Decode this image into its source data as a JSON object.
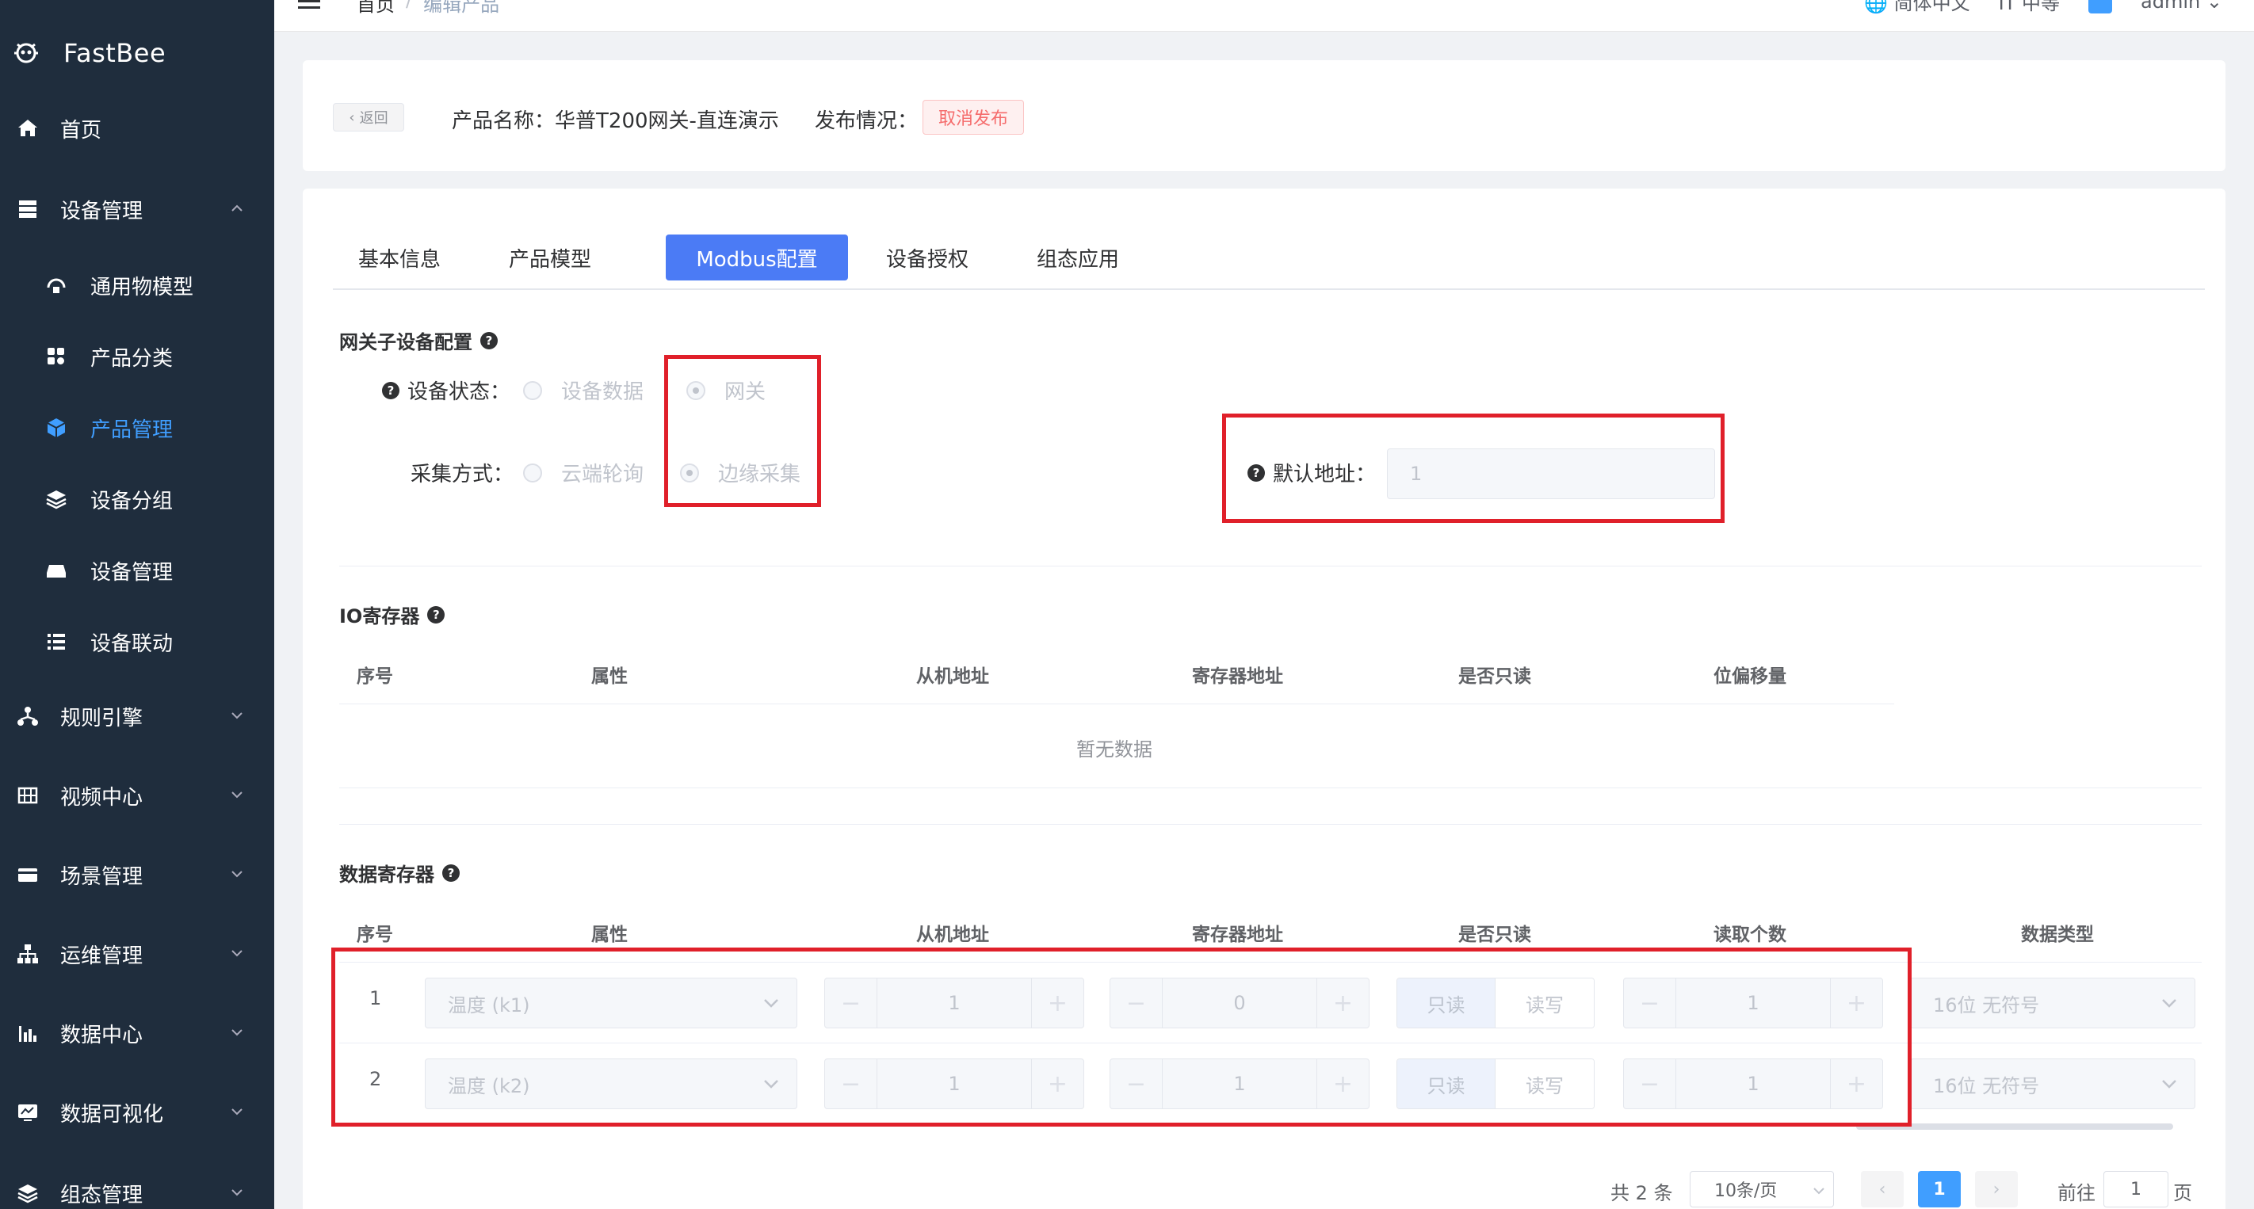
{
  "brand": {
    "name": "FastBee"
  },
  "sidebar": {
    "items": [
      {
        "label": "首页",
        "icon": "home-icon"
      },
      {
        "label": "设备管理",
        "icon": "device-icon"
      },
      {
        "label": "通用物模型",
        "icon": "model-icon"
      },
      {
        "label": "产品分类",
        "icon": "category-icon"
      },
      {
        "label": "产品管理",
        "icon": "cube-icon"
      },
      {
        "label": "设备分组",
        "icon": "layers-icon"
      },
      {
        "label": "设备管理",
        "icon": "drive-icon"
      },
      {
        "label": "设备联动",
        "icon": "list-icon"
      },
      {
        "label": "规则引擎",
        "icon": "rule-icon"
      },
      {
        "label": "视频中心",
        "icon": "grid-icon"
      },
      {
        "label": "场景管理",
        "icon": "card-icon"
      },
      {
        "label": "运维管理",
        "icon": "tree-icon"
      },
      {
        "label": "数据中心",
        "icon": "bar-chart-icon"
      },
      {
        "label": "数据可视化",
        "icon": "monitor-icon"
      },
      {
        "label": "组态管理",
        "icon": "layers-icon"
      }
    ]
  },
  "header": {
    "breadcrumb": [
      "首页",
      "编辑产品"
    ],
    "lang": "简体中文",
    "size": "中等",
    "user": "admin"
  },
  "product": {
    "back_label": "返回",
    "name_label": "产品名称：",
    "name_value": "华普T200网关-直连演示",
    "publish_label": "发布情况：",
    "publish_tag": "取消发布"
  },
  "tabs": [
    "基本信息",
    "产品模型",
    "Modbus配置",
    "设备授权",
    "组态应用"
  ],
  "gateway": {
    "title": "网关子设备配置",
    "status_label": "设备状态：",
    "status_options": [
      "设备数据",
      "网关"
    ],
    "collect_label": "采集方式：",
    "collect_options": [
      "云端轮询",
      "边缘采集"
    ],
    "addr_label": "默认地址：",
    "addr_value": "1"
  },
  "io": {
    "title": "IO寄存器",
    "headers": [
      "序号",
      "属性",
      "从机地址",
      "寄存器地址",
      "是否只读",
      "位偏移量"
    ],
    "empty": "暂无数据"
  },
  "data_reg": {
    "title": "数据寄存器",
    "headers": [
      "序号",
      "属性",
      "从机地址",
      "寄存器地址",
      "是否只读",
      "读取个数",
      "数据类型"
    ],
    "readonly_opts": [
      "只读",
      "读写"
    ],
    "rows": [
      {
        "idx": "1",
        "attr": "温度 (k1)",
        "slave": "1",
        "reg": "0",
        "count": "1",
        "type": "16位 无符号"
      },
      {
        "idx": "2",
        "attr": "温度 (k2)",
        "slave": "1",
        "reg": "1",
        "count": "1",
        "type": "16位 无符号"
      }
    ]
  },
  "pager": {
    "total": "共 2 条",
    "size": "10条/页",
    "page": "1",
    "goto_label": "前往",
    "goto_value": "1",
    "page_unit": "页"
  },
  "colors": {
    "sidebar": "#1f2d3d",
    "accent": "#4b7bf5",
    "highlight": "#e0202a",
    "danger": "#f56c6c"
  }
}
